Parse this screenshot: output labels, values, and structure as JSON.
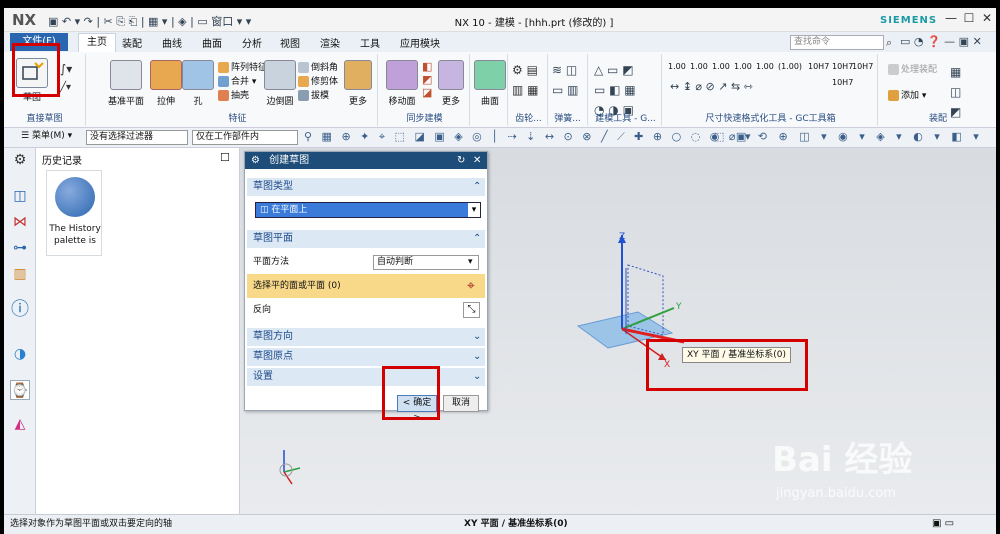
{
  "app": {
    "logo": "NX",
    "title": "NX 10 - 建模 - [hhh.prt  (修改的) ]",
    "brand": "SIEMENS",
    "window_buttons": [
      "—",
      "☐",
      "✕"
    ]
  },
  "menu": {
    "file": "文件(F)",
    "tabs": [
      "主页",
      "装配",
      "曲线",
      "曲面",
      "分析",
      "视图",
      "渲染",
      "工具",
      "应用模块"
    ],
    "command_search_placeholder": "查找命令"
  },
  "ribbon": {
    "groups": [
      {
        "label": "直接草图",
        "big": "草图"
      },
      {
        "label": "特征",
        "items": [
          "基准平面",
          "拉伸",
          "孔",
          "阵列特征",
          "合并",
          "抽壳",
          "边倒圆",
          "倒斜角",
          "修剪体",
          "拔模",
          "更多"
        ]
      },
      {
        "label": "同步建模",
        "items": [
          "移动面",
          "更多"
        ]
      },
      {
        "label": "曲面",
        "items": [
          "曲面"
        ]
      },
      {
        "label": "齿轮...",
        "items": []
      },
      {
        "label": "弹簧...",
        "items": []
      },
      {
        "label": "建模工具 - G...",
        "items": []
      },
      {
        "label": "尺寸快速格式化工具 - GC工具箱",
        "items": [
          "1.00",
          "1.00",
          "1.00",
          "1.00",
          "1.00",
          "(1.00)",
          "10H7",
          "10H7",
          "10H7",
          "10H7"
        ]
      },
      {
        "label": "装配",
        "items": [
          "处理装配",
          "添加"
        ]
      }
    ]
  },
  "toolbar2": {
    "menu": "菜单(M)",
    "filter": "没有选择过滤器",
    "scope": "仅在工作部件内"
  },
  "history": {
    "title": "历史记录",
    "card_text": "The History palette is"
  },
  "dialog": {
    "title": "创建草图",
    "sections": {
      "type": "草图类型",
      "type_value": "在平面上",
      "plane": "草图平面",
      "plane_method_label": "平面方法",
      "plane_method_value": "自动判断",
      "select_label": "选择平的面或平面 (0)",
      "reverse_label": "反向",
      "orientation": "草图方向",
      "origin": "草图原点",
      "settings": "设置"
    },
    "ok": "< 确定 >",
    "cancel": "取消"
  },
  "viewport": {
    "tooltip": "XY 平面 / 基准坐标系(0)",
    "axis_x": "X",
    "axis_y": "Y",
    "axis_z": "Z"
  },
  "status": {
    "left": "选择对象作为草图平面或双击要定向的轴",
    "center": "XY 平面 / 基准坐标系(0)"
  },
  "watermark": {
    "brand": "Bai 经验",
    "url": "jingyan.baidu.com"
  }
}
